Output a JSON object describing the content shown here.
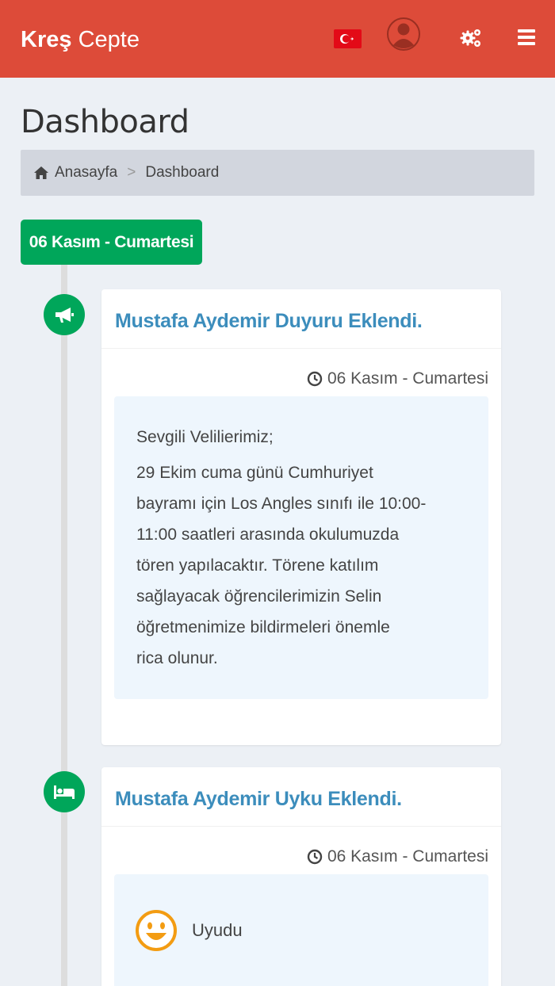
{
  "header": {
    "brand_bold": "Kreş",
    "brand_light": "Cepte",
    "bg_color": "#dd4b39",
    "icons": [
      "turkey-flag-icon",
      "user-avatar-icon",
      "gears-icon",
      "hamburger-menu-icon"
    ]
  },
  "page": {
    "title": "Dashboard"
  },
  "breadcrumb": {
    "home": "Anasayfa",
    "separator": ">",
    "current": "Dashboard"
  },
  "timeline": {
    "date_label": "06 Kasım - Cumartesi",
    "accent_color": "#00a65a",
    "items": [
      {
        "icon": "megaphone-icon",
        "title": "Mustafa Aydemir Duyuru Eklendi.",
        "time": "06 Kasım - Cumartesi",
        "greeting": "Sevgili Velilierimiz;",
        "message_lines": [
          "29 Ekim cuma günü Cumhuriyet",
          "bayramı için Los Angles sınıfı ile 10:00-",
          "11:00 saatleri arasında okulumuzda",
          "tören yapılacaktır. Törene katılım",
          "sağlayacak öğrencilerimizin Selin",
          "öğretmenimize bildirmeleri önemle",
          "rica olunur."
        ]
      },
      {
        "icon": "bed-icon",
        "title": "Mustafa Aydemir Uyku Eklendi.",
        "time": "06 Kasım - Cumartesi",
        "status": "Uyudu",
        "status_icon": "smiley-icon"
      }
    ]
  }
}
